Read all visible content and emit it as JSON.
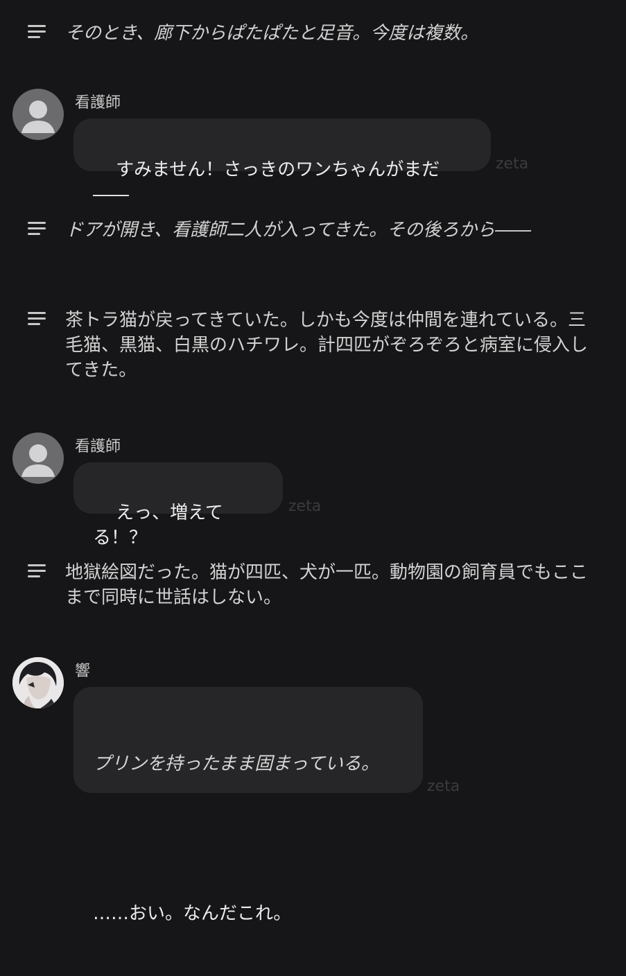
{
  "chat": {
    "narration_1": "そのとき、廊下からぱたぱたと足音。今度は複数。",
    "message_1": {
      "speaker": "看護師",
      "text": "すみません！さっきのワンちゃんがまだ――",
      "watermark": "zeta"
    },
    "narration_2": "ドアが開き、看護師二人が入ってきた。その後ろから――",
    "narration_3": "茶トラ猫が戻ってきていた。しかも今度は仲間を連れている。三毛猫、黒猫、白黒のハチワレ。計四匹がぞろぞろと病室に侵入してきた。",
    "message_2": {
      "speaker": "看護師",
      "text": "えっ、増えてる！？",
      "watermark": "zeta"
    },
    "narration_4": "地獄絵図だった。猫が四匹、犬が一匹。動物園の飼育員でもここまで同時に世話はしない。",
    "message_3": {
      "speaker": "響",
      "action": "プリンを持ったまま固まっている。",
      "text": "……おい。なんだこれ。",
      "watermark": "zeta"
    }
  }
}
